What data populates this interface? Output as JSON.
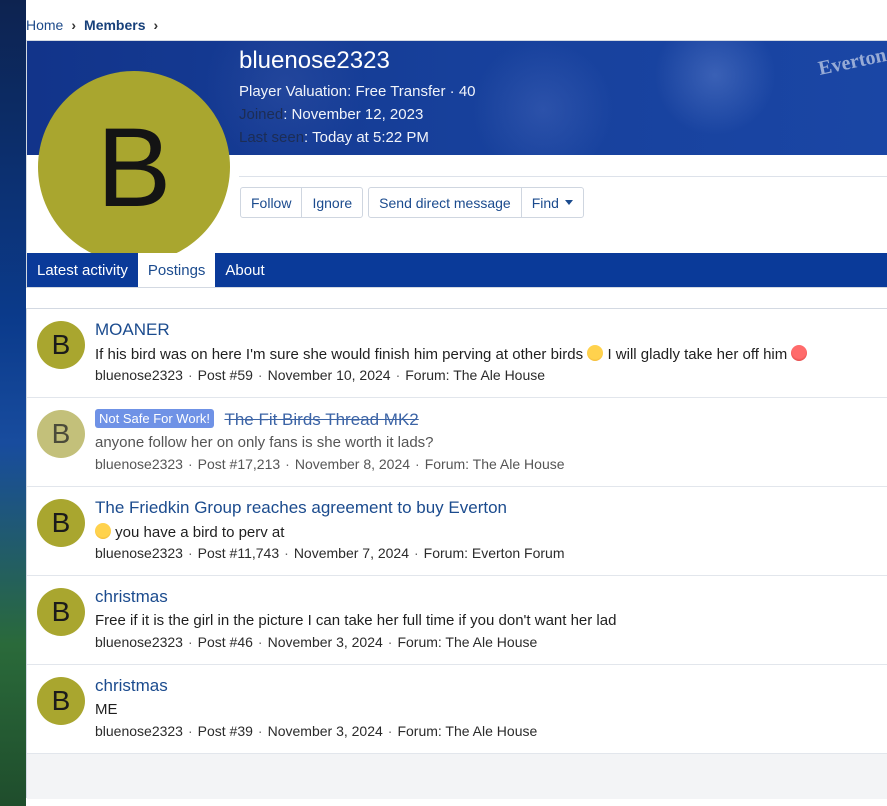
{
  "breadcrumb": {
    "home": "Home",
    "members": "Members"
  },
  "profile": {
    "avatar_letter": "B",
    "username": "bluenose2323",
    "valuation": "Player Valuation: Free Transfer · 40",
    "joined_label": "Joined",
    "joined_value": "November 12, 2023",
    "last_seen_label": "Last seen",
    "last_seen_value": "Today at 5:22 PM",
    "banner_text": "Everton"
  },
  "buttons": {
    "follow": "Follow",
    "ignore": "Ignore",
    "dm": "Send direct message",
    "find": "Find"
  },
  "tabs": [
    "Latest activity",
    "Postings",
    "About"
  ],
  "posts": [
    {
      "avatar": "B",
      "title": "MOANER",
      "snippet_a": "If his bird was on here I'm sure she would finish him perving at other birds",
      "snippet_b": "I will gladly take her off him",
      "author": "bluenose2323",
      "post": "Post #59",
      "date": "November 10, 2024",
      "forum": "Forum: The Ale House"
    },
    {
      "avatar": "B",
      "badge": "Not Safe For Work!",
      "title": "The Fit Birds Thread MK2",
      "snippet": "anyone follow her on only fans is she worth it lads?",
      "author": "bluenose2323",
      "post": "Post #17,213",
      "date": "November 8, 2024",
      "forum": "Forum: The Ale House"
    },
    {
      "avatar": "B",
      "title": "The Friedkin Group reaches agreement to buy Everton",
      "snippet": "you have a bird to perv at",
      "author": "bluenose2323",
      "post": "Post #11,743",
      "date": "November 7, 2024",
      "forum": "Forum: Everton Forum"
    },
    {
      "avatar": "B",
      "title": "christmas",
      "snippet": "Free if it is the girl in the picture I can take her full time if you don't want her lad",
      "author": "bluenose2323",
      "post": "Post #46",
      "date": "November 3, 2024",
      "forum": "Forum: The Ale House"
    },
    {
      "avatar": "B",
      "title": "christmas",
      "snippet": "ME",
      "author": "bluenose2323",
      "post": "Post #39",
      "date": "November 3, 2024",
      "forum": "Forum: The Ale House"
    }
  ],
  "colors": {
    "accent": "#0a3a99",
    "avatar": "#a9a62f",
    "link": "#1b4b8e"
  }
}
